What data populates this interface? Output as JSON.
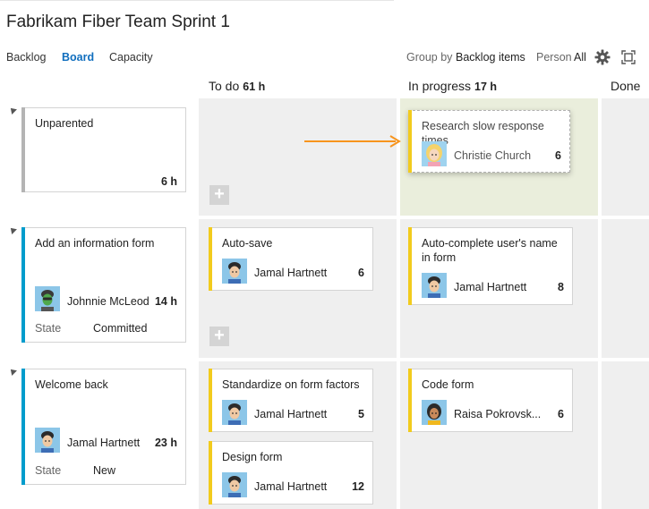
{
  "header": {
    "title": "Fabrikam Fiber Team Sprint 1",
    "tabs": [
      "Backlog",
      "Board",
      "Capacity"
    ],
    "active_tab": "Board",
    "group_by_label": "Group by",
    "group_by_value": "Backlog items",
    "person_label": "Person",
    "person_value": "All",
    "settings_icon": "gear-icon",
    "fullscreen_icon": "fullscreen-icon"
  },
  "columns": [
    {
      "name": "To do",
      "hours": "61 h"
    },
    {
      "name": "In progress",
      "hours": "17 h"
    },
    {
      "name": "Done",
      "hours": ""
    }
  ],
  "rows": [
    {
      "parent": {
        "title": "Unparented",
        "estimate": "6 h",
        "bar_color": "#b4b4b4"
      },
      "in_progress": [
        {
          "title": "Research slow response times",
          "assignee": "Christie Church",
          "estimate": "6",
          "dragging": true
        }
      ]
    },
    {
      "parent": {
        "title": "Add an information form",
        "assignee": "Johnnie McLeod",
        "estimate": "14 h",
        "state_label": "State",
        "state": "Committed",
        "bar_color": "#009ccc"
      },
      "todo": [
        {
          "title": "Auto-save",
          "assignee": "Jamal Hartnett",
          "estimate": "6"
        }
      ],
      "in_progress": [
        {
          "title": "Auto-complete user's name in form",
          "assignee": "Jamal Hartnett",
          "estimate": "8"
        }
      ]
    },
    {
      "parent": {
        "title": "Welcome back",
        "assignee": "Jamal Hartnett",
        "estimate": "23 h",
        "state_label": "State",
        "state": "New",
        "bar_color": "#009ccc"
      },
      "todo": [
        {
          "title": "Standardize on form factors",
          "assignee": "Jamal Hartnett",
          "estimate": "5"
        },
        {
          "title": "Design form",
          "assignee": "Jamal Hartnett",
          "estimate": "12"
        }
      ],
      "in_progress": [
        {
          "title": "Code form",
          "assignee": "Raisa Pokrovsk...",
          "estimate": "6"
        }
      ]
    }
  ],
  "add_button_label": "+",
  "task_bar_color": "#f2cb1d",
  "highlight_color": "#eaeedc",
  "arrow_color": "#f7941d"
}
